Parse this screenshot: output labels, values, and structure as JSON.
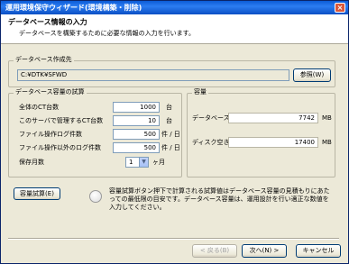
{
  "window": {
    "title": "運用環境保守ウィザード(環境構築・削除)",
    "close_label": "×"
  },
  "header": {
    "title": "データベース情報の入力",
    "description": "データベースを構築するために必要な情報の入力を行います。"
  },
  "db_location": {
    "group_label": "データベース作成先",
    "path": "C:¥DTK¥SFWD",
    "browse_label": "参照(W)"
  },
  "estimate": {
    "group_label": "データベース容量の試算",
    "rows": [
      {
        "label": "全体のCT台数",
        "value": "1000",
        "unit": "台"
      },
      {
        "label": "このサーバで管理するCT台数",
        "value": "10",
        "unit": "台"
      },
      {
        "label": "ファイル操作ログ件数",
        "value": "500",
        "unit": "件 / 日"
      },
      {
        "label": "ファイル操作以外のログ件数",
        "value": "500",
        "unit": "件 / 日"
      }
    ],
    "retention": {
      "label": "保存月数",
      "value": "1",
      "unit": "ヶ月"
    }
  },
  "capacity": {
    "group_label": "容量",
    "db_size": {
      "label": "データベース容量",
      "value": "7742",
      "unit": "MB"
    },
    "free_space": {
      "label": "ディスク空き容量",
      "value": "17400",
      "unit": "MB"
    }
  },
  "calc": {
    "button_label": "容量試算(E)",
    "info_text": "容量試算ボタン押下で計算される試算値はデータベース容量の見積もりにあたっての最低限の目安です。データベース容量は、運用設計を行い適正な数値を入力してください。"
  },
  "footer": {
    "back_label": "< 戻る(B)",
    "next_label": "次へ(N) >",
    "cancel_label": "キャンセル"
  }
}
